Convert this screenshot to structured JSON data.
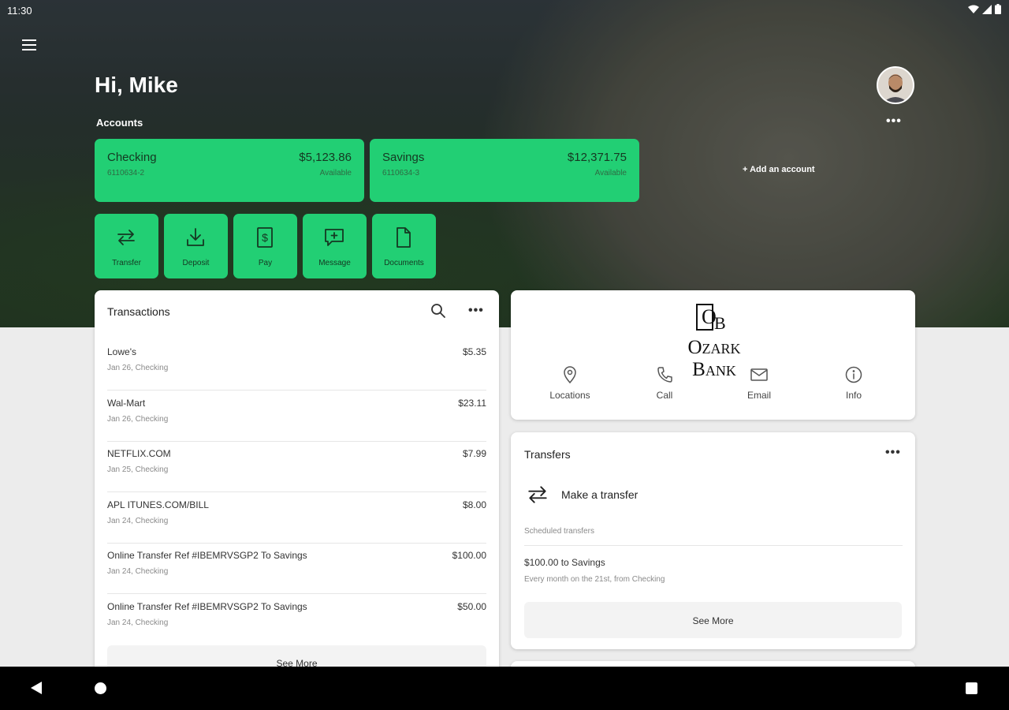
{
  "status_bar": {
    "time": "11:30"
  },
  "header": {
    "greeting": "Hi, Mike",
    "accounts_label": "Accounts",
    "add_account": "+ Add an account",
    "avatar_more": "•••"
  },
  "accounts": [
    {
      "name": "Checking",
      "balance": "$5,123.86",
      "number": "6110634-2",
      "balance_label": "Available"
    },
    {
      "name": "Savings",
      "balance": "$12,371.75",
      "number": "6110634-3",
      "balance_label": "Available"
    }
  ],
  "quick_actions": [
    {
      "label": "Transfer",
      "icon": "transfer-icon"
    },
    {
      "label": "Deposit",
      "icon": "deposit-icon"
    },
    {
      "label": "Pay",
      "icon": "pay-icon"
    },
    {
      "label": "Message",
      "icon": "message-icon"
    },
    {
      "label": "Documents",
      "icon": "documents-icon"
    }
  ],
  "transactions": {
    "title": "Transactions",
    "more": "•••",
    "items": [
      {
        "name": "Lowe's",
        "amount": "$5.35",
        "sub": "Jan 26, Checking"
      },
      {
        "name": "Wal-Mart",
        "amount": "$23.11",
        "sub": "Jan 26, Checking"
      },
      {
        "name": "NETFLIX.COM",
        "amount": "$7.99",
        "sub": "Jan 25, Checking"
      },
      {
        "name": "APL ITUNES.COM/BILL",
        "amount": "$8.00",
        "sub": "Jan 24, Checking"
      },
      {
        "name": "Online Transfer Ref #IBEMRVSGP2 To Savings",
        "amount": "$100.00",
        "sub": "Jan 24, Checking"
      },
      {
        "name": "Online Transfer Ref #IBEMRVSGP2 To Savings",
        "amount": "$50.00",
        "sub": "Jan 24, Checking"
      }
    ],
    "see_more": "See More"
  },
  "bank": {
    "name": "Ozark Bank",
    "actions": [
      {
        "label": "Locations",
        "icon": "location-pin-icon"
      },
      {
        "label": "Call",
        "icon": "phone-icon"
      },
      {
        "label": "Email",
        "icon": "email-icon"
      },
      {
        "label": "Info",
        "icon": "info-icon"
      }
    ]
  },
  "transfers": {
    "title": "Transfers",
    "more": "•••",
    "make_transfer": "Make a transfer",
    "scheduled_label": "Scheduled transfers",
    "scheduled_item": "$100.00 to Savings",
    "scheduled_item_sub": "Every month on the 21st, from Checking",
    "see_more": "See More"
  },
  "colors": {
    "accent": "#22cf74",
    "accent_text": "#153822"
  }
}
